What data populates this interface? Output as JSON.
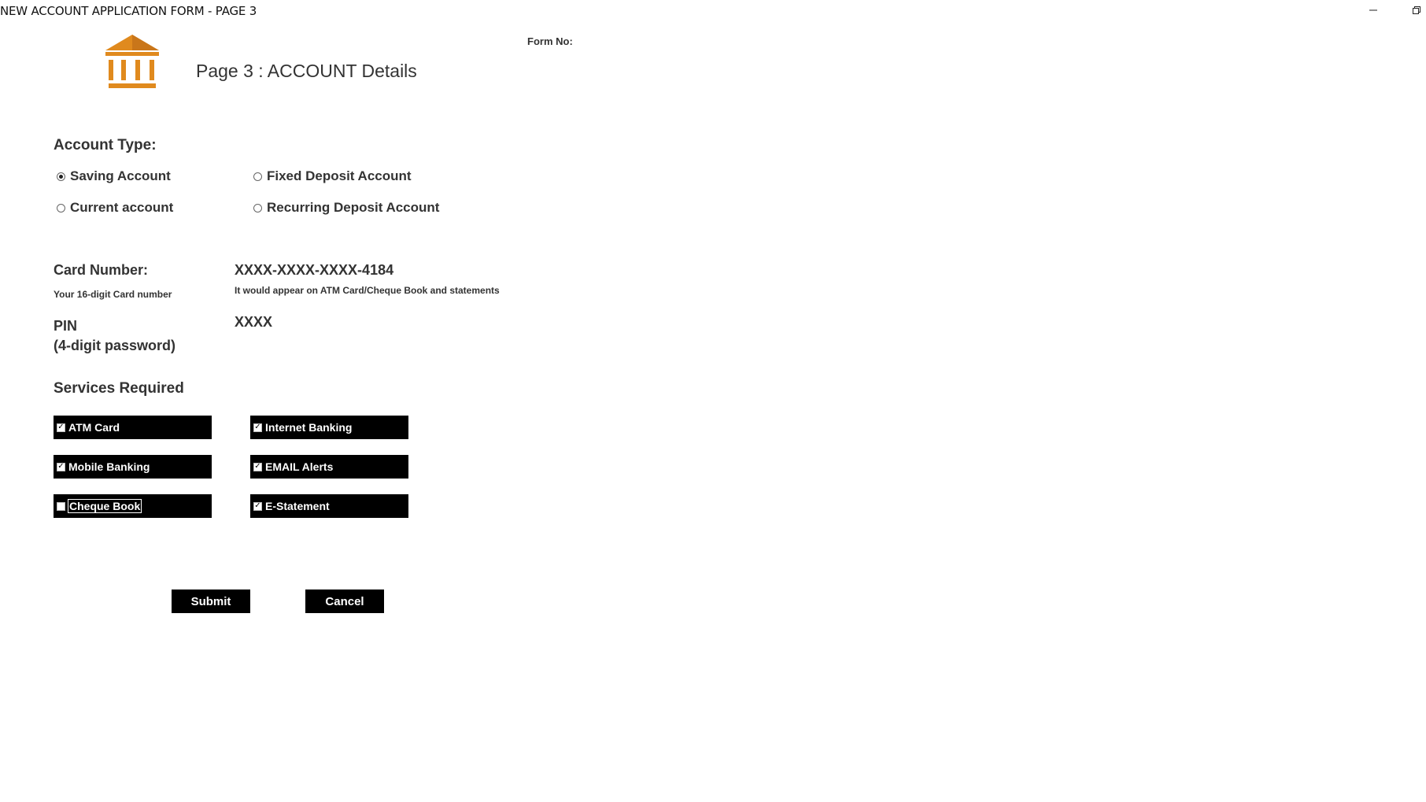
{
  "window": {
    "title": "NEW ACCOUNT APPLICATION FORM - PAGE 3",
    "minimize_icon": "minimize-icon",
    "restore_icon": "restore-icon"
  },
  "header": {
    "logo_icon": "bank-icon",
    "logo_color": "#E08A1E",
    "page_title": "Page 3 : ACCOUNT Details",
    "form_no_label": "Form No:",
    "form_no_value": ""
  },
  "account_type": {
    "label": "Account Type:",
    "options": [
      {
        "label": "Saving Account",
        "selected": true
      },
      {
        "label": "Fixed Deposit Account",
        "selected": false
      },
      {
        "label": "Current account",
        "selected": false
      },
      {
        "label": "Recurring Deposit Account",
        "selected": false
      }
    ]
  },
  "card": {
    "label": "Card Number:",
    "hint": "Your 16-digit Card number",
    "value": "XXXX-XXXX-XXXX-4184",
    "value_hint": "It would appear on ATM Card/Cheque Book and statements"
  },
  "pin": {
    "label": "PIN",
    "sublabel": "(4-digit password)",
    "value": "XXXX"
  },
  "services": {
    "label": "Services Required",
    "items": [
      {
        "label": "ATM Card",
        "checked": true
      },
      {
        "label": "Internet Banking",
        "checked": true
      },
      {
        "label": "Mobile Banking",
        "checked": true
      },
      {
        "label": "EMAIL Alerts",
        "checked": true
      },
      {
        "label": "Cheque Book",
        "checked": false
      },
      {
        "label": "E-Statement",
        "checked": true
      }
    ]
  },
  "actions": {
    "submit_label": "Submit",
    "cancel_label": "Cancel"
  }
}
